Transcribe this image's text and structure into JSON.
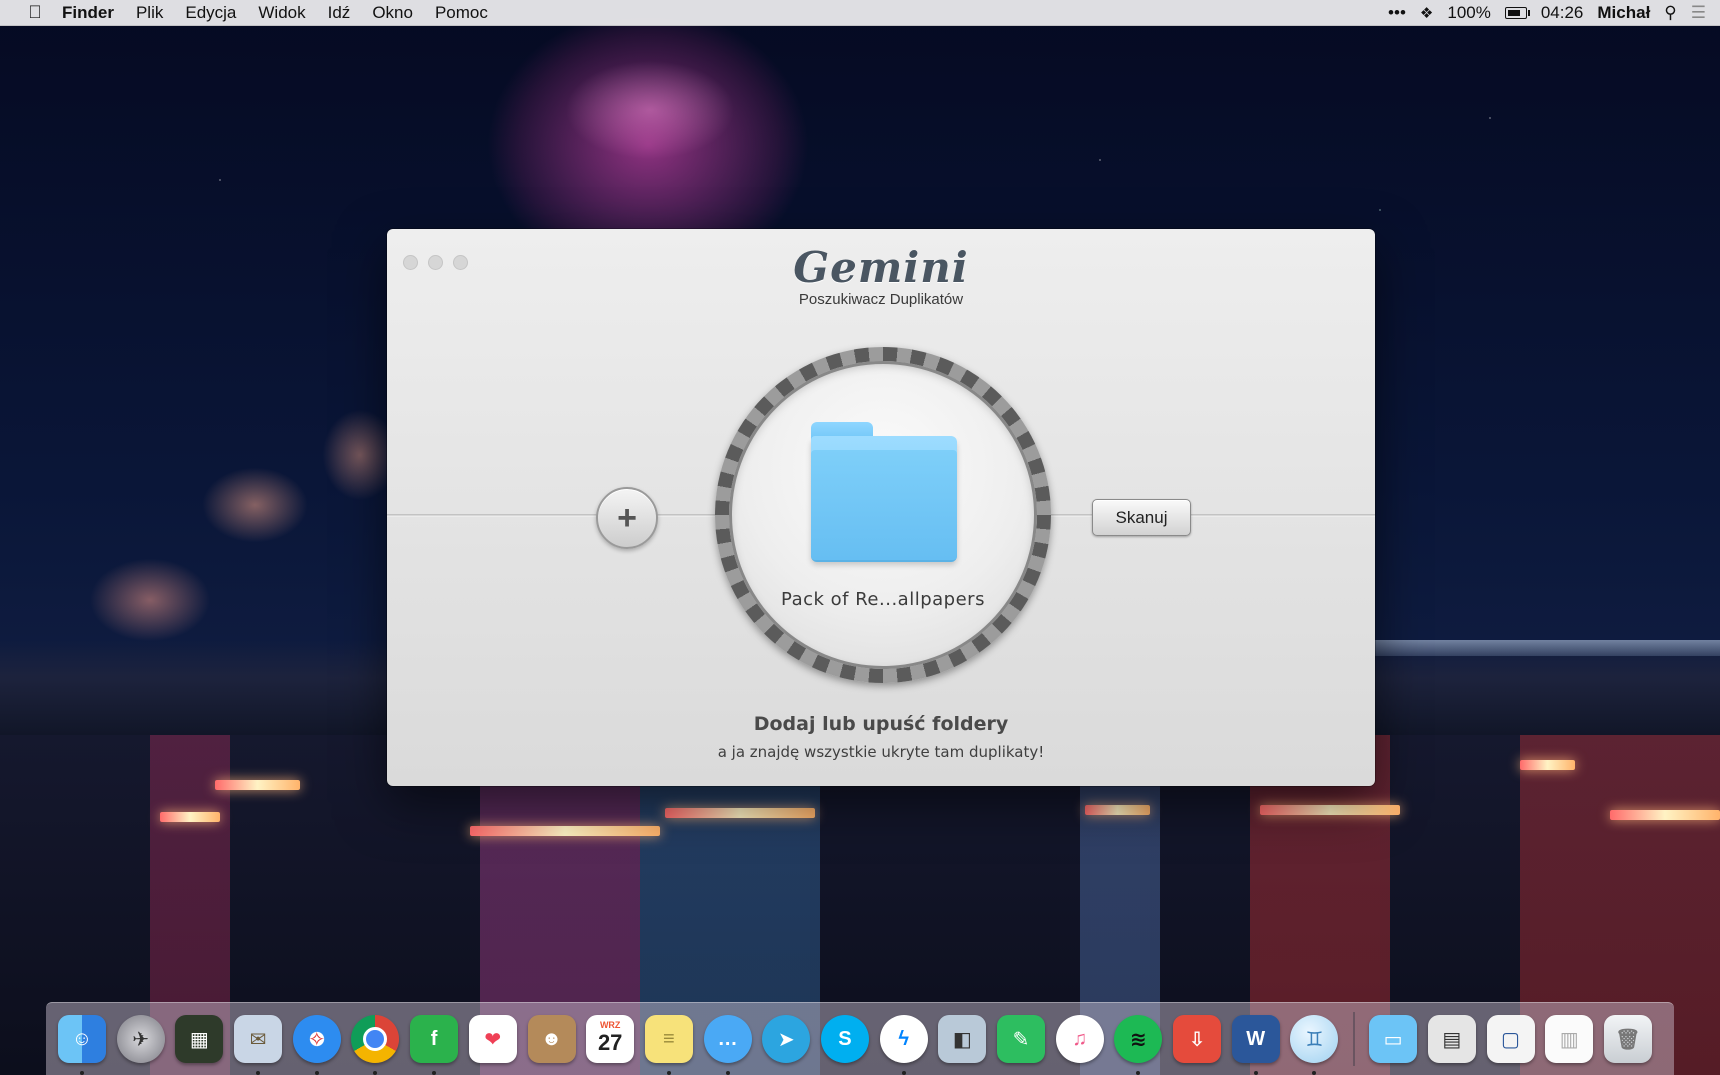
{
  "menubar": {
    "apple_icon": "apple-icon",
    "app_name": "Finder",
    "menus": [
      "Plik",
      "Edycja",
      "Widok",
      "Idź",
      "Okno",
      "Pomoc"
    ],
    "status": {
      "more": "•••",
      "battery_percent": "100%",
      "time": "04:26",
      "user": "Michał",
      "search_icon": "magnifier-icon",
      "list_icon": "notification-list-icon"
    }
  },
  "window": {
    "logo": "Gemini",
    "subtitle": "Poszukiwacz Duplikatów",
    "add_button": "+",
    "folder_name": "Pack of Re...allpapers",
    "scan_button": "Skanuj",
    "hint_title": "Dodaj lub upuść foldery",
    "hint_body": "a ja znajdę wszystkie ukryte tam duplikaty!"
  },
  "dock": {
    "calendar_month": "WRZ",
    "calendar_day": "27",
    "apps": [
      {
        "name": "finder-icon",
        "color": "#3a8ee6"
      },
      {
        "name": "launchpad-icon",
        "color": "#8c8c94"
      },
      {
        "name": "mission-control-icon",
        "color": "#2e3a2a"
      },
      {
        "name": "mail-icon",
        "color": "#c9d6e6"
      },
      {
        "name": "safari-icon",
        "color": "#2d8cf0"
      },
      {
        "name": "chrome-icon",
        "color": "#e8e8e8"
      },
      {
        "name": "feedly-icon",
        "color": "#2bb24c"
      },
      {
        "name": "pocket-icon",
        "color": "#ef4056"
      },
      {
        "name": "contacts-icon",
        "color": "#b48a5a"
      },
      {
        "name": "calendar-icon",
        "color": "#ffffff"
      },
      {
        "name": "notes-icon",
        "color": "#f7e27a"
      },
      {
        "name": "messages-icon",
        "color": "#4aa9f5"
      },
      {
        "name": "telegram-icon",
        "color": "#2ca5e0"
      },
      {
        "name": "skype-icon",
        "color": "#00aff0"
      },
      {
        "name": "messenger-icon",
        "color": "#0084ff"
      },
      {
        "name": "preview-icon",
        "color": "#b9c9d8"
      },
      {
        "name": "evernote-icon",
        "color": "#2dbe60"
      },
      {
        "name": "itunes-icon",
        "color": "#f05a8a"
      },
      {
        "name": "spotify-icon",
        "color": "#1db954"
      },
      {
        "name": "transmit-icon",
        "color": "#e54b3c"
      },
      {
        "name": "word-icon",
        "color": "#2b579a"
      },
      {
        "name": "gemini-icon",
        "color": "#9fd1f0"
      }
    ],
    "right_items": [
      {
        "name": "downloads-folder-icon",
        "color": "#6cc4f6"
      },
      {
        "name": "document-stack-icon",
        "color": "#e5e5e5"
      },
      {
        "name": "document-preview-icon",
        "color": "#f4f4f4"
      },
      {
        "name": "notes-document-icon",
        "color": "#fbfbfb"
      },
      {
        "name": "trash-icon",
        "color": "#dfe3e6"
      }
    ]
  }
}
